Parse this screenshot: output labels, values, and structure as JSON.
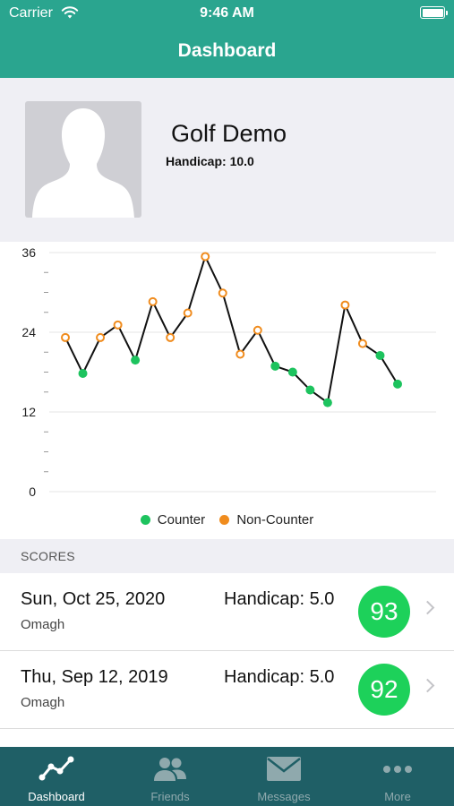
{
  "status_bar": {
    "carrier": "Carrier",
    "time": "9:46 AM"
  },
  "nav": {
    "title": "Dashboard"
  },
  "profile": {
    "name": "Golf Demo",
    "handicap": "Handicap: 10.0"
  },
  "chart_data": {
    "type": "line",
    "title": "",
    "xlabel": "",
    "ylabel": "",
    "ylim": [
      0,
      36
    ],
    "yticks": [
      "36",
      "24",
      "12",
      "0"
    ],
    "grid": true,
    "legend_placement": "bottom",
    "series": [
      {
        "values": [
          23.2,
          17.8,
          23.2,
          25.1,
          19.8,
          28.6,
          23.2,
          26.9,
          35.4,
          29.9,
          20.7,
          24.3,
          18.9,
          18.0,
          15.3,
          13.4,
          28.1,
          22.3,
          20.5,
          16.2
        ],
        "types": [
          "non-counter",
          "counter",
          "non-counter",
          "non-counter",
          "counter",
          "non-counter",
          "non-counter",
          "non-counter",
          "non-counter",
          "non-counter",
          "non-counter",
          "non-counter",
          "counter",
          "counter",
          "counter",
          "counter",
          "non-counter",
          "non-counter",
          "counter",
          "counter"
        ]
      }
    ],
    "legend": [
      {
        "key": "counter",
        "label": "Counter",
        "color": "#1dc35e"
      },
      {
        "key": "non-counter",
        "label": "Non-Counter",
        "color": "#f08c1e"
      }
    ]
  },
  "scores": {
    "section_title": "SCORES",
    "rows": [
      {
        "date": "Sun, Oct 25, 2020",
        "course": "Omagh",
        "handicap": "Handicap: 5.0",
        "score": "93"
      },
      {
        "date": "Thu, Sep 12, 2019",
        "course": "Omagh",
        "handicap": "Handicap: 5.0",
        "score": "92"
      }
    ]
  },
  "tabs": [
    {
      "label": "Dashboard",
      "icon": "chart-line-icon",
      "active": true
    },
    {
      "label": "Friends",
      "icon": "friends-icon",
      "active": false
    },
    {
      "label": "Messages",
      "icon": "envelope-icon",
      "active": false
    },
    {
      "label": "More",
      "icon": "ellipsis-icon",
      "active": false
    }
  ],
  "colors": {
    "brand": "#2aa58f",
    "tabbar": "#1f5f66",
    "score_badge": "#1dd15a"
  }
}
